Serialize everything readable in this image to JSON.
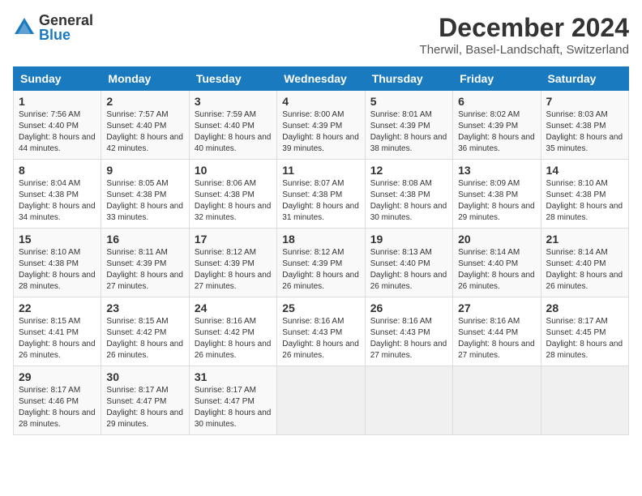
{
  "header": {
    "logo_general": "General",
    "logo_blue": "Blue",
    "month_title": "December 2024",
    "subtitle": "Therwil, Basel-Landschaft, Switzerland"
  },
  "weekdays": [
    "Sunday",
    "Monday",
    "Tuesday",
    "Wednesday",
    "Thursday",
    "Friday",
    "Saturday"
  ],
  "weeks": [
    [
      {
        "day": "1",
        "sunrise": "7:56 AM",
        "sunset": "4:40 PM",
        "daylight": "8 hours and 44 minutes."
      },
      {
        "day": "2",
        "sunrise": "7:57 AM",
        "sunset": "4:40 PM",
        "daylight": "8 hours and 42 minutes."
      },
      {
        "day": "3",
        "sunrise": "7:59 AM",
        "sunset": "4:40 PM",
        "daylight": "8 hours and 40 minutes."
      },
      {
        "day": "4",
        "sunrise": "8:00 AM",
        "sunset": "4:39 PM",
        "daylight": "8 hours and 39 minutes."
      },
      {
        "day": "5",
        "sunrise": "8:01 AM",
        "sunset": "4:39 PM",
        "daylight": "8 hours and 38 minutes."
      },
      {
        "day": "6",
        "sunrise": "8:02 AM",
        "sunset": "4:39 PM",
        "daylight": "8 hours and 36 minutes."
      },
      {
        "day": "7",
        "sunrise": "8:03 AM",
        "sunset": "4:38 PM",
        "daylight": "8 hours and 35 minutes."
      }
    ],
    [
      {
        "day": "8",
        "sunrise": "8:04 AM",
        "sunset": "4:38 PM",
        "daylight": "8 hours and 34 minutes."
      },
      {
        "day": "9",
        "sunrise": "8:05 AM",
        "sunset": "4:38 PM",
        "daylight": "8 hours and 33 minutes."
      },
      {
        "day": "10",
        "sunrise": "8:06 AM",
        "sunset": "4:38 PM",
        "daylight": "8 hours and 32 minutes."
      },
      {
        "day": "11",
        "sunrise": "8:07 AM",
        "sunset": "4:38 PM",
        "daylight": "8 hours and 31 minutes."
      },
      {
        "day": "12",
        "sunrise": "8:08 AM",
        "sunset": "4:38 PM",
        "daylight": "8 hours and 30 minutes."
      },
      {
        "day": "13",
        "sunrise": "8:09 AM",
        "sunset": "4:38 PM",
        "daylight": "8 hours and 29 minutes."
      },
      {
        "day": "14",
        "sunrise": "8:10 AM",
        "sunset": "4:38 PM",
        "daylight": "8 hours and 28 minutes."
      }
    ],
    [
      {
        "day": "15",
        "sunrise": "8:10 AM",
        "sunset": "4:38 PM",
        "daylight": "8 hours and 28 minutes."
      },
      {
        "day": "16",
        "sunrise": "8:11 AM",
        "sunset": "4:39 PM",
        "daylight": "8 hours and 27 minutes."
      },
      {
        "day": "17",
        "sunrise": "8:12 AM",
        "sunset": "4:39 PM",
        "daylight": "8 hours and 27 minutes."
      },
      {
        "day": "18",
        "sunrise": "8:12 AM",
        "sunset": "4:39 PM",
        "daylight": "8 hours and 26 minutes."
      },
      {
        "day": "19",
        "sunrise": "8:13 AM",
        "sunset": "4:40 PM",
        "daylight": "8 hours and 26 minutes."
      },
      {
        "day": "20",
        "sunrise": "8:14 AM",
        "sunset": "4:40 PM",
        "daylight": "8 hours and 26 minutes."
      },
      {
        "day": "21",
        "sunrise": "8:14 AM",
        "sunset": "4:40 PM",
        "daylight": "8 hours and 26 minutes."
      }
    ],
    [
      {
        "day": "22",
        "sunrise": "8:15 AM",
        "sunset": "4:41 PM",
        "daylight": "8 hours and 26 minutes."
      },
      {
        "day": "23",
        "sunrise": "8:15 AM",
        "sunset": "4:42 PM",
        "daylight": "8 hours and 26 minutes."
      },
      {
        "day": "24",
        "sunrise": "8:16 AM",
        "sunset": "4:42 PM",
        "daylight": "8 hours and 26 minutes."
      },
      {
        "day": "25",
        "sunrise": "8:16 AM",
        "sunset": "4:43 PM",
        "daylight": "8 hours and 26 minutes."
      },
      {
        "day": "26",
        "sunrise": "8:16 AM",
        "sunset": "4:43 PM",
        "daylight": "8 hours and 27 minutes."
      },
      {
        "day": "27",
        "sunrise": "8:16 AM",
        "sunset": "4:44 PM",
        "daylight": "8 hours and 27 minutes."
      },
      {
        "day": "28",
        "sunrise": "8:17 AM",
        "sunset": "4:45 PM",
        "daylight": "8 hours and 28 minutes."
      }
    ],
    [
      {
        "day": "29",
        "sunrise": "8:17 AM",
        "sunset": "4:46 PM",
        "daylight": "8 hours and 28 minutes."
      },
      {
        "day": "30",
        "sunrise": "8:17 AM",
        "sunset": "4:47 PM",
        "daylight": "8 hours and 29 minutes."
      },
      {
        "day": "31",
        "sunrise": "8:17 AM",
        "sunset": "4:47 PM",
        "daylight": "8 hours and 30 minutes."
      },
      null,
      null,
      null,
      null
    ]
  ]
}
